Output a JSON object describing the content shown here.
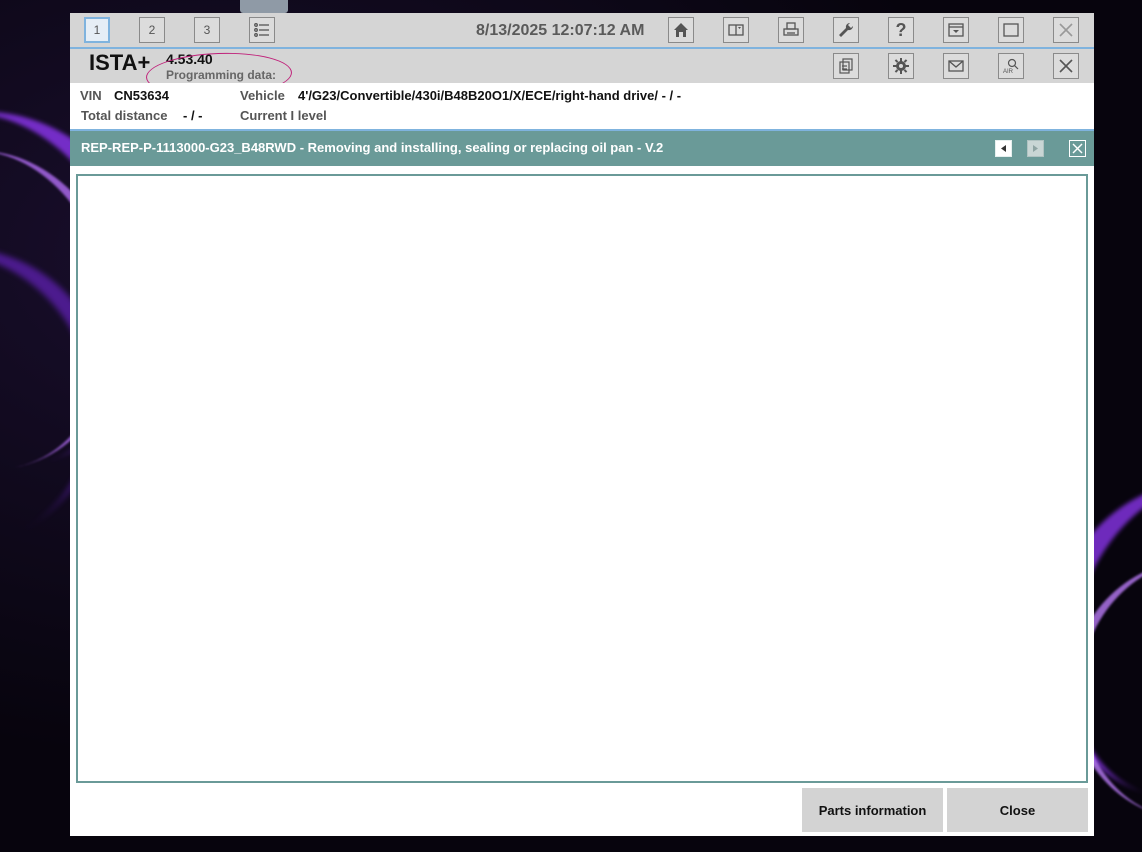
{
  "toolbar": {
    "tabs": [
      {
        "label": "1"
      },
      {
        "label": "2"
      },
      {
        "label": "3"
      }
    ],
    "datetime": "8/13/2025 12:07:12 AM"
  },
  "header": {
    "brand": "ISTA+",
    "version": "4.53.40",
    "programming_label": "Programming data:"
  },
  "vehicle": {
    "vin_label": "VIN",
    "vin": "CN53634",
    "vehicle_label": "Vehicle",
    "vehicle_value": "4'/G23/Convertible/430i/B48B20O1/X/ECE/right-hand drive/ - / -",
    "distance_label": "Total distance",
    "distance_value": "- / -",
    "ilevel_label": "Current I level"
  },
  "document": {
    "title": "REP-REP-P-1113000-G23_B48RWD - Removing and installing, sealing or replacing oil pan - V.2"
  },
  "buttons": {
    "parts_info": "Parts information",
    "close": "Close"
  },
  "colors": {
    "toolbar_bg": "#d5d5d5",
    "accent_blue": "#7fb3de",
    "titlebar_teal": "#6a9a98",
    "annotation_magenta": "#c0217a"
  }
}
